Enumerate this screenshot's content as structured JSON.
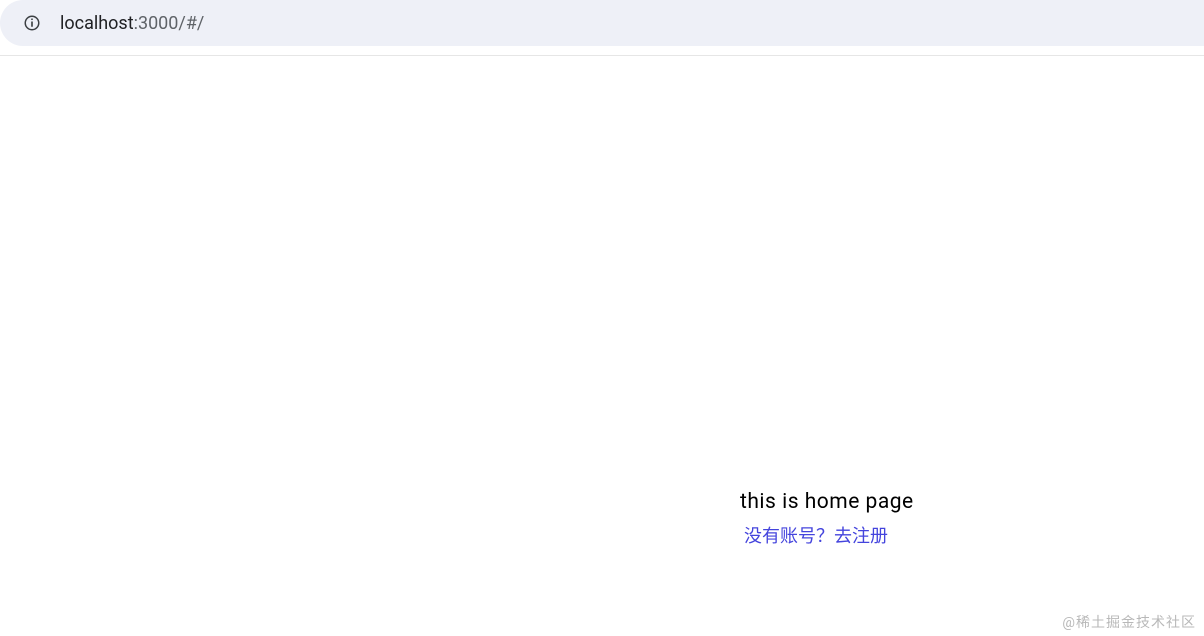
{
  "addressBar": {
    "host": "localhost",
    "portPath": ":3000/#/"
  },
  "content": {
    "title": "this is home page",
    "registerPrompt": "没有账号？去注册"
  },
  "watermark": "@稀土掘金技术社区"
}
